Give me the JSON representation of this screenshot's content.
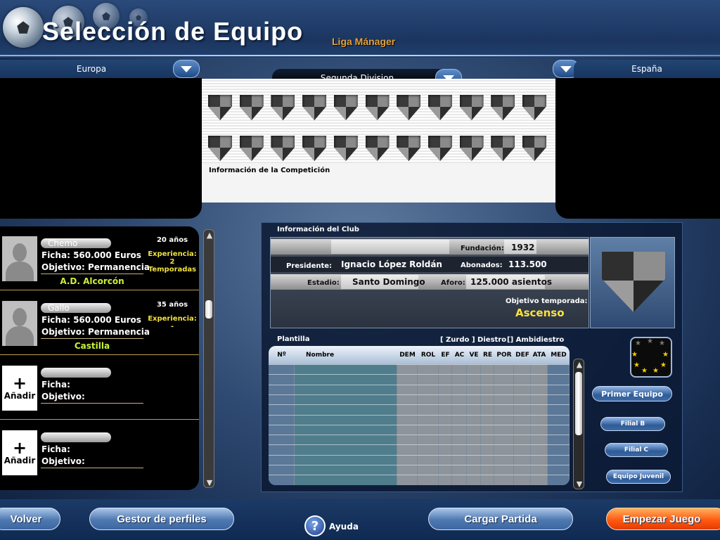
{
  "header": {
    "title": "Selección de Equipo",
    "subtitle": "Liga Mánager"
  },
  "region_selector": {
    "value": "Europa"
  },
  "division_selector": {
    "value": "Segunda Division"
  },
  "country_selector": {
    "value": "España"
  },
  "competition": {
    "info_label": "Información de la Competición",
    "team_rows": 2,
    "teams_per_row": 11
  },
  "players": [
    {
      "name": "Chemo",
      "age": "20 años",
      "fee_label": "Ficha:",
      "fee_value": "560.000 Euros",
      "objective_label": "Objetivo:",
      "objective_value": "Permanencia",
      "experience_label": "Experiencia:",
      "experience_value": "2 Temporadas",
      "team": "A.D. Alcorcón"
    },
    {
      "name": "Gallo",
      "age": "35 años",
      "fee_label": "Ficha:",
      "fee_value": "560.000 Euros",
      "objective_label": "Objetivo:",
      "objective_value": "Permanencia",
      "experience_label": "Experiencia:",
      "experience_value": "-",
      "team": "Castilla"
    },
    {
      "add_label": "Añadir",
      "plus": "+",
      "fee_label": "Ficha:",
      "objective_label": "Objetivo:"
    },
    {
      "add_label": "Añadir",
      "plus": "+",
      "fee_label": "Ficha:",
      "objective_label": "Objetivo:"
    }
  ],
  "club": {
    "section_label": "Información del  Club",
    "foundation_label": "Fundación:",
    "foundation_value": "1932",
    "president_label": "Presidente:",
    "president_value": "Ignacio López Roldán",
    "members_label": "Abonados:",
    "members_value": "113.500",
    "stadium_label": "Estadio:",
    "stadium_value": "Santo Domingo",
    "capacity_label": "Aforo:",
    "capacity_value": "125.000 asientos",
    "objective_label": "Objetivo temporada:",
    "objective_value": "Ascenso"
  },
  "squad": {
    "label": "Plantilla",
    "legend_left": "[ Zurdo",
    "legend_mid": "] Diestro",
    "legend_right": "[] Ambidiestro",
    "columns": [
      "Nº",
      "Nombre",
      "DEM",
      "ROL",
      "EF",
      "AC",
      "VE",
      "RE",
      "POR",
      "DEF",
      "ATA",
      "MED"
    ],
    "row_count": 12
  },
  "team_buttons": {
    "first": "Primer Equipo",
    "b": "Filial B",
    "c": "Filial C",
    "youth": "Equipo Juvenil"
  },
  "footer": {
    "back": "Volver",
    "profiles": "Gestor de perfiles",
    "help": "Ayuda",
    "help_symbol": "?",
    "load": "Cargar Partida",
    "start": "Empezar Juego"
  },
  "colors": {
    "accent_orange": "#e3a23a",
    "experience_yellow": "#f0e03c",
    "team_green": "#c9f03a",
    "objective_yellow": "#ffe23a"
  }
}
